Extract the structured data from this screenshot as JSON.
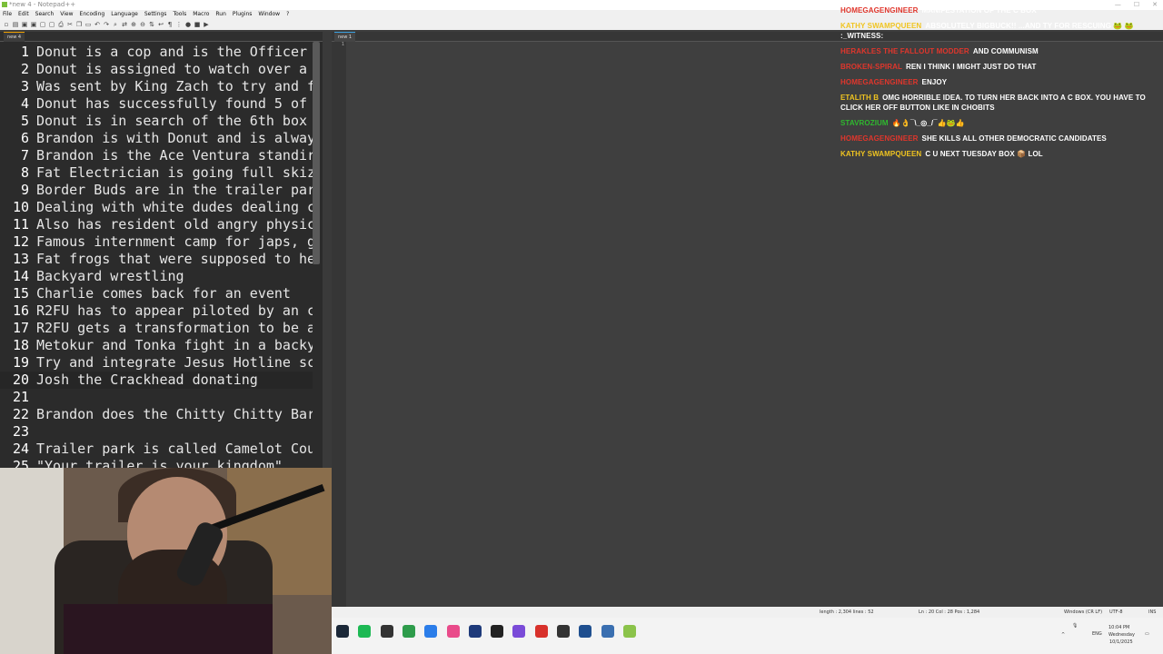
{
  "window": {
    "title": "*new 4 - Notepad++"
  },
  "menu": [
    "File",
    "Edit",
    "Search",
    "View",
    "Encoding",
    "Language",
    "Settings",
    "Tools",
    "Macro",
    "Run",
    "Plugins",
    "Window",
    "?"
  ],
  "left_pane": {
    "tab_label": "new 4",
    "lines": [
      {
        "n": "1",
        "t": "Donut is a cop and is the Officer"
      },
      {
        "n": "2",
        "t": "Donut is assigned to watch over a"
      },
      {
        "n": "3",
        "t": "Was sent by King Zach to try and f"
      },
      {
        "n": "4",
        "t": "Donut has successfully found 5 of"
      },
      {
        "n": "5",
        "t": "Donut is in search of the 6th box"
      },
      {
        "n": "6",
        "t": "Brandon is with Donut and is alway"
      },
      {
        "n": "7",
        "t": "Brandon is the Ace Ventura standir"
      },
      {
        "n": "8",
        "t": "Fat Electrician is going full skiz"
      },
      {
        "n": "9",
        "t": "Border Buds are in the trailer par"
      },
      {
        "n": "10",
        "t": "Dealing with white dudes dealing c"
      },
      {
        "n": "11",
        "t": "Also has resident old angry physic"
      },
      {
        "n": "12",
        "t": "Famous internment camp for japs, g"
      },
      {
        "n": "13",
        "t": "Fat frogs that were supposed to he"
      },
      {
        "n": "14",
        "t": "Backyard wrestling"
      },
      {
        "n": "15",
        "t": "Charlie comes back for an event"
      },
      {
        "n": "16",
        "t": "R2FU has to appear piloted by an c"
      },
      {
        "n": "17",
        "t": "R2FU gets a transformation to be a"
      },
      {
        "n": "18",
        "t": "Metokur and Tonka fight in a backy"
      },
      {
        "n": "19",
        "t": "Try and integrate Jesus Hotline sc"
      },
      {
        "n": "20",
        "t": "Josh the Crackhead donating"
      },
      {
        "n": "21",
        "t": ""
      },
      {
        "n": "22",
        "t": "Brandon does the Chitty Chitty Bar"
      },
      {
        "n": "23",
        "t": ""
      },
      {
        "n": "24",
        "t": "Trailer park is called Camelot Cou"
      },
      {
        "n": "25",
        "t": "\"Your trailer is your kingdom\""
      }
    ]
  },
  "right_pane": {
    "tab_label": "new 1",
    "gutter_line": "1"
  },
  "chat": [
    {
      "user": "HOMEGAGENGINEER",
      "user_color": "#e0362c",
      "text": "MANIFESTATION OF THE C BOX"
    },
    {
      "user": "KATHY SWAMPQUEEN",
      "user_color": "#f0c420",
      "text": "ABSOLUTELY BIGBUCK!! ...AND TY FOR RESCUING 🐸 🐸 :_WITNESS:"
    },
    {
      "user": "HERAKLES THE FALLOUT MODDER",
      "user_color": "#e0362c",
      "text": "AND COMMUNISM"
    },
    {
      "user": "BROKEN-SPIRAL",
      "user_color": "#e0362c",
      "text": "REN I THINK I MIGHT JUST DO THAT"
    },
    {
      "user": "HOMEGAGENGINEER",
      "user_color": "#e0362c",
      "text": "ENJOY"
    },
    {
      "user": "ETALITH B",
      "user_color": "#f0c420",
      "text": "OMG HORRIBLE IDEA. TO TURN HER BACK INTO A C BOX. YOU HAVE TO CLICK HER OFF BUTTON LIKE IN CHOBITS"
    },
    {
      "user": "STAVROZIUM",
      "user_color": "#2fb82f",
      "text": "🔥👌¯\\_◎_/¯👍🐸👍"
    },
    {
      "user": "HOMEGAGENGINEER",
      "user_color": "#e0362c",
      "text": "SHE KILLS ALL OTHER DEMOCRATIC CANDIDATES"
    },
    {
      "user": "KATHY SWAMPQUEEN",
      "user_color": "#f0c420",
      "text": "C U NEXT TUESDAY BOX 📦 LOL"
    }
  ],
  "status": {
    "length": "length : 2,304    lines : 52",
    "position": "Ln : 20    Col : 28    Pos : 1,284",
    "eol": "Windows (CR LF)",
    "encoding": "UTF-8",
    "mode": "INS"
  },
  "taskbar": {
    "time": "10:04 PM",
    "day": "Wednesday",
    "date": "10/1/2025",
    "lang": "ENG",
    "icons": [
      {
        "name": "steam",
        "color": "#1b2838"
      },
      {
        "name": "spotify",
        "color": "#1db954"
      },
      {
        "name": "app",
        "color": "#333333"
      },
      {
        "name": "edge",
        "color": "#2e9c4b"
      },
      {
        "name": "app-blue",
        "color": "#2b7de9"
      },
      {
        "name": "app-multicolor",
        "color": "#e94b8a"
      },
      {
        "name": "terminal",
        "color": "#1e3a7a"
      },
      {
        "name": "obsidian",
        "color": "#222222"
      },
      {
        "name": "app-purple",
        "color": "#7a4bd8"
      },
      {
        "name": "app-red",
        "color": "#d8312b"
      },
      {
        "name": "app-dark",
        "color": "#333333"
      },
      {
        "name": "app-doc",
        "color": "#1f4f8f"
      },
      {
        "name": "calculator",
        "color": "#3a6fb0"
      },
      {
        "name": "notepadpp",
        "color": "#8bc34a"
      }
    ]
  }
}
